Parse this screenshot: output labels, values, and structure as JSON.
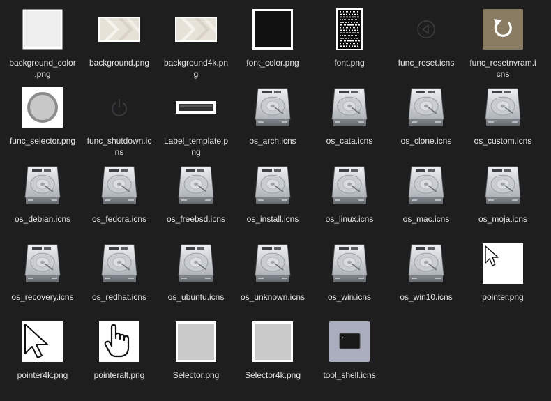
{
  "window": {
    "view": "icon-view",
    "background": "#1e1e1f"
  },
  "files": [
    {
      "name": "background_color.png",
      "label_lines": [
        "background_color",
        ".png"
      ],
      "icon": "white-square-icon"
    },
    {
      "name": "background.png",
      "label_lines": [
        "background.png"
      ],
      "icon": "background-image-icon"
    },
    {
      "name": "background4k.png",
      "label_lines": [
        "background4k.pn",
        "g"
      ],
      "icon": "background-image-icon"
    },
    {
      "name": "font_color.png",
      "label_lines": [
        "font_color.png"
      ],
      "icon": "black-square-icon"
    },
    {
      "name": "font.png",
      "label_lines": [
        "font.png"
      ],
      "icon": "font-sheet-icon"
    },
    {
      "name": "func_reset.icns",
      "label_lines": [
        "func_reset.icns"
      ],
      "icon": "reset-arrow-icon"
    },
    {
      "name": "func_resetnvram.icns",
      "label_lines": [
        "func_resetnvram.i",
        "cns"
      ],
      "icon": "reset-nvram-icon"
    },
    {
      "name": "func_selector.png",
      "label_lines": [
        "func_selector.png"
      ],
      "icon": "selector-circle-icon"
    },
    {
      "name": "func_shutdown.icns",
      "label_lines": [
        "func_shutdown.ic",
        "ns"
      ],
      "icon": "power-icon"
    },
    {
      "name": "Label_template.png",
      "label_lines": [
        "Label_template.p",
        "ng"
      ],
      "icon": "label-bar-icon"
    },
    {
      "name": "os_arch.icns",
      "label_lines": [
        "os_arch.icns"
      ],
      "icon": "hard-drive-icon"
    },
    {
      "name": "os_cata.icns",
      "label_lines": [
        "os_cata.icns"
      ],
      "icon": "hard-drive-icon"
    },
    {
      "name": "os_clone.icns",
      "label_lines": [
        "os_clone.icns"
      ],
      "icon": "hard-drive-icon"
    },
    {
      "name": "os_custom.icns",
      "label_lines": [
        "os_custom.icns"
      ],
      "icon": "hard-drive-icon"
    },
    {
      "name": "os_debian.icns",
      "label_lines": [
        "os_debian.icns"
      ],
      "icon": "hard-drive-icon"
    },
    {
      "name": "os_fedora.icns",
      "label_lines": [
        "os_fedora.icns"
      ],
      "icon": "hard-drive-icon"
    },
    {
      "name": "os_freebsd.icns",
      "label_lines": [
        "os_freebsd.icns"
      ],
      "icon": "hard-drive-icon"
    },
    {
      "name": "os_install.icns",
      "label_lines": [
        "os_install.icns"
      ],
      "icon": "hard-drive-icon"
    },
    {
      "name": "os_linux.icns",
      "label_lines": [
        "os_linux.icns"
      ],
      "icon": "hard-drive-icon"
    },
    {
      "name": "os_mac.icns",
      "label_lines": [
        "os_mac.icns"
      ],
      "icon": "hard-drive-icon"
    },
    {
      "name": "os_moja.icns",
      "label_lines": [
        "os_moja.icns"
      ],
      "icon": "hard-drive-icon"
    },
    {
      "name": "os_recovery.icns",
      "label_lines": [
        "os_recovery.icns"
      ],
      "icon": "hard-drive-icon"
    },
    {
      "name": "os_redhat.icns",
      "label_lines": [
        "os_redhat.icns"
      ],
      "icon": "hard-drive-icon"
    },
    {
      "name": "os_ubuntu.icns",
      "label_lines": [
        "os_ubuntu.icns"
      ],
      "icon": "hard-drive-icon"
    },
    {
      "name": "os_unknown.icns",
      "label_lines": [
        "os_unknown.icns"
      ],
      "icon": "hard-drive-icon"
    },
    {
      "name": "os_win.icns",
      "label_lines": [
        "os_win.icns"
      ],
      "icon": "hard-drive-icon"
    },
    {
      "name": "os_win10.icns",
      "label_lines": [
        "os_win10.icns"
      ],
      "icon": "hard-drive-icon"
    },
    {
      "name": "pointer.png",
      "label_lines": [
        "pointer.png"
      ],
      "icon": "arrow-pointer-icon"
    },
    {
      "name": "pointer4k.png",
      "label_lines": [
        "pointer4k.png"
      ],
      "icon": "arrow-pointer-large-icon"
    },
    {
      "name": "pointeralt.png",
      "label_lines": [
        "pointeralt.png"
      ],
      "icon": "hand-pointer-icon"
    },
    {
      "name": "Selector.png",
      "label_lines": [
        "Selector.png"
      ],
      "icon": "gray-square-icon"
    },
    {
      "name": "Selector4k.png",
      "label_lines": [
        "Selector4k.png"
      ],
      "icon": "gray-square-icon"
    },
    {
      "name": "tool_shell.icns",
      "label_lines": [
        "tool_shell.icns"
      ],
      "icon": "terminal-icon"
    }
  ],
  "colors": {
    "label_text": "#e6e6e6",
    "resetnvram_tile": "#8a7c62",
    "shell_tile": "#a9adbd"
  }
}
